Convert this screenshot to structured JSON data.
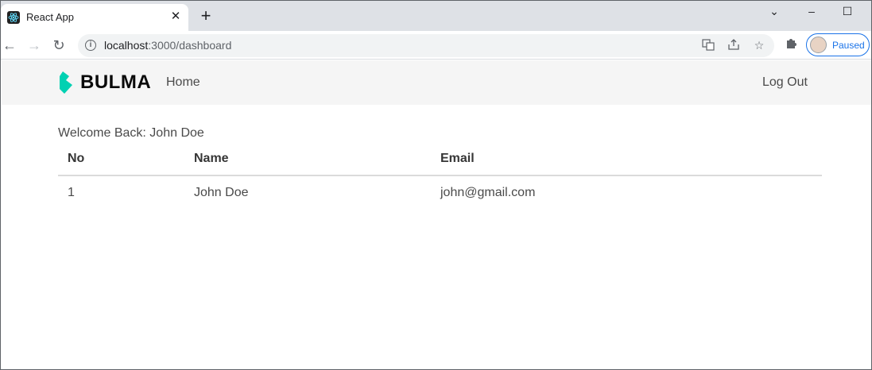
{
  "browser": {
    "tab_title": "React App",
    "tab_close": "✕",
    "new_tab": "+",
    "url_host": "localhost",
    "url_rest": ":3000/dashboard",
    "profile_status": "Paused",
    "window_controls": {
      "dropdown": "⌄",
      "minimize": "–",
      "maximize": "☐"
    },
    "nav_icons": {
      "back": "←",
      "forward": "→",
      "reload": "↻"
    }
  },
  "navbar": {
    "brand": "BULMA",
    "brand_color": "#00d1b2",
    "home_label": "Home",
    "logout_label": "Log Out"
  },
  "main": {
    "welcome": "Welcome Back: John Doe",
    "table": {
      "headers": [
        "No",
        "Name",
        "Email"
      ],
      "rows": [
        [
          "1",
          "John Doe",
          "john@gmail.com"
        ]
      ]
    }
  }
}
